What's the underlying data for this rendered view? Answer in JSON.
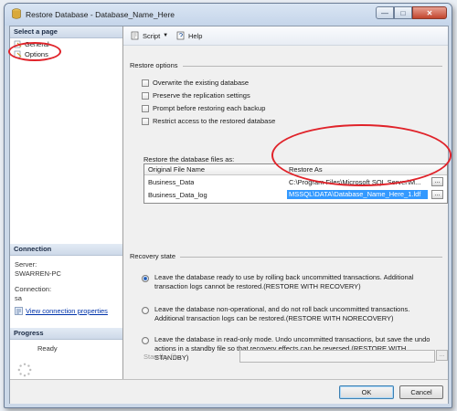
{
  "window": {
    "title": "Restore Database - Database_Name_Here"
  },
  "left": {
    "select_header": "Select a page",
    "pages": [
      {
        "label": "General"
      },
      {
        "label": "Options"
      }
    ],
    "connection_header": "Connection",
    "server_label": "Server:",
    "server_value": "SWARREN-PC",
    "connection_label": "Connection:",
    "connection_value": "sa",
    "view_link": "View connection properties",
    "progress_header": "Progress",
    "progress_status": "Ready"
  },
  "toolbar": {
    "script_label": "Script",
    "help_label": "Help"
  },
  "restore_options": {
    "title": "Restore options",
    "options": [
      {
        "label": "Overwrite the existing database",
        "checked": false
      },
      {
        "label": "Preserve the replication settings",
        "checked": false
      },
      {
        "label": "Prompt before restoring each backup",
        "checked": false
      },
      {
        "label": "Restrict access to the restored database",
        "checked": false
      }
    ]
  },
  "files": {
    "label": "Restore the database files as:",
    "headers": {
      "original": "Original File Name",
      "restore_as": "Restore As"
    },
    "rows": [
      {
        "original": "Business_Data",
        "restore_as": "C:\\Program Files\\Microsoft SQL Server\\M...",
        "selected": false
      },
      {
        "original": "Business_Data_log",
        "restore_as": "MSSQL\\DATA\\Database_Name_Here_1.ldf",
        "selected": true
      }
    ],
    "browse_label": "..."
  },
  "recovery": {
    "title": "Recovery state",
    "options": [
      {
        "text": "Leave the database ready to use by rolling back uncommitted transactions. Additional transaction logs cannot be restored.(RESTORE WITH RECOVERY)",
        "selected": true
      },
      {
        "text": "Leave the database non-operational, and do not roll back uncommitted transactions. Additional transaction logs can be restored.(RESTORE WITH NORECOVERY)",
        "selected": false
      },
      {
        "text": "Leave the database in read-only mode. Undo uncommitted transactions, but save the undo actions in a standby file so that recovery effects can be reversed.(RESTORE WITH STANDBY)",
        "selected": false
      }
    ],
    "standby_label": "Standby file:",
    "standby_value": "",
    "browse_label": "..."
  },
  "footer": {
    "ok_label": "OK",
    "cancel_label": "Cancel"
  },
  "colors": {
    "highlight_oval": "#e0232a",
    "selection": "#3399ff",
    "accent": "#0033aa"
  }
}
